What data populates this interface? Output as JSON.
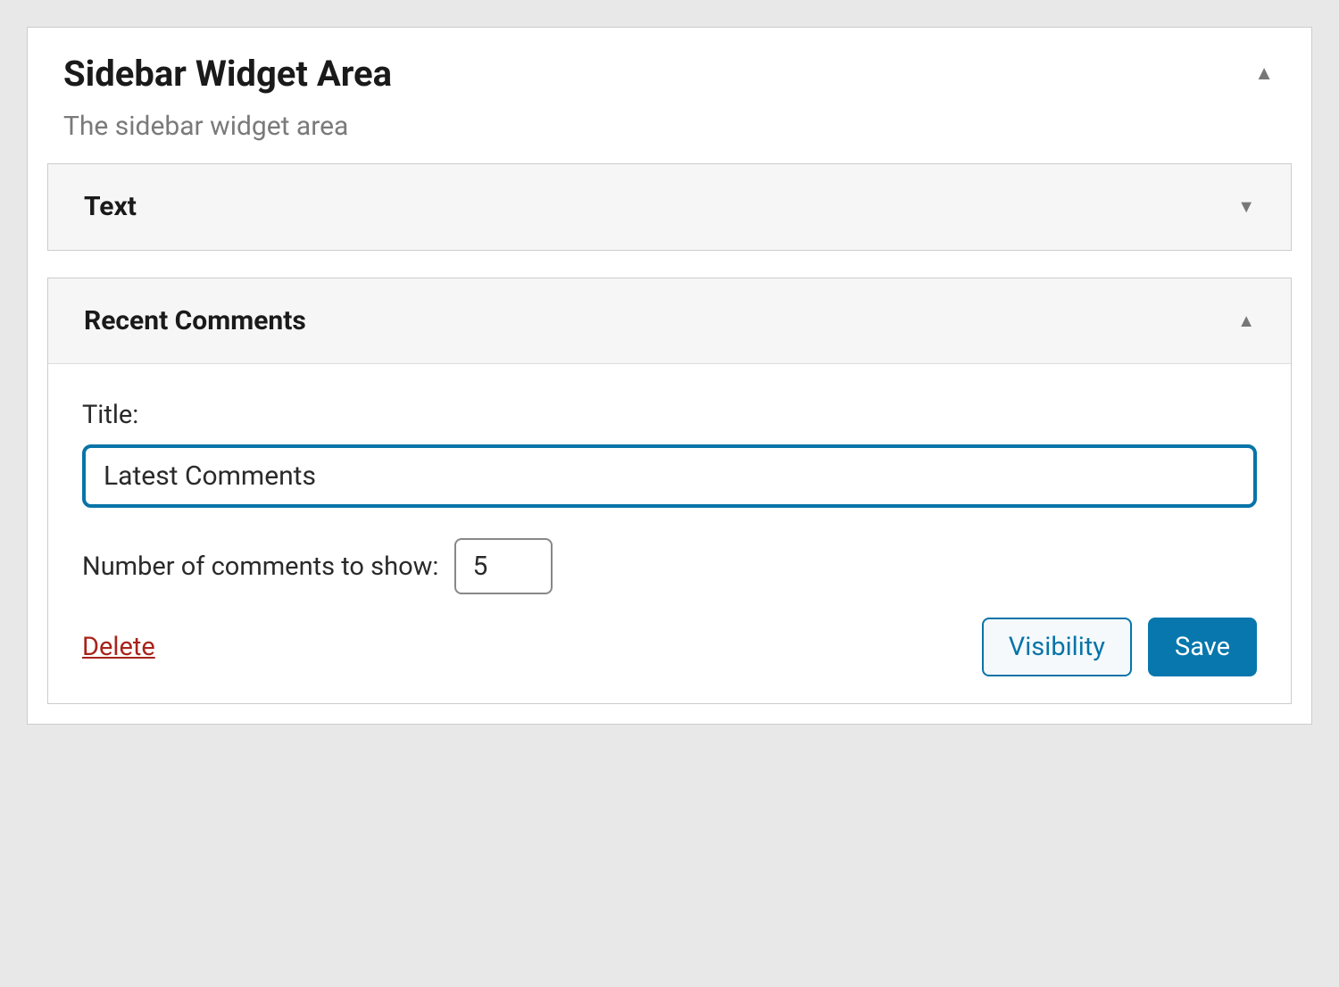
{
  "panel": {
    "title": "Sidebar Widget Area",
    "description": "The sidebar widget area"
  },
  "widgets": {
    "text": {
      "title": "Text"
    },
    "recent_comments": {
      "title": "Recent Comments",
      "fields": {
        "title_label": "Title:",
        "title_value": "Latest Comments",
        "count_label": "Number of comments to show:",
        "count_value": "5"
      },
      "actions": {
        "delete": "Delete",
        "visibility": "Visibility",
        "save": "Save"
      }
    }
  }
}
